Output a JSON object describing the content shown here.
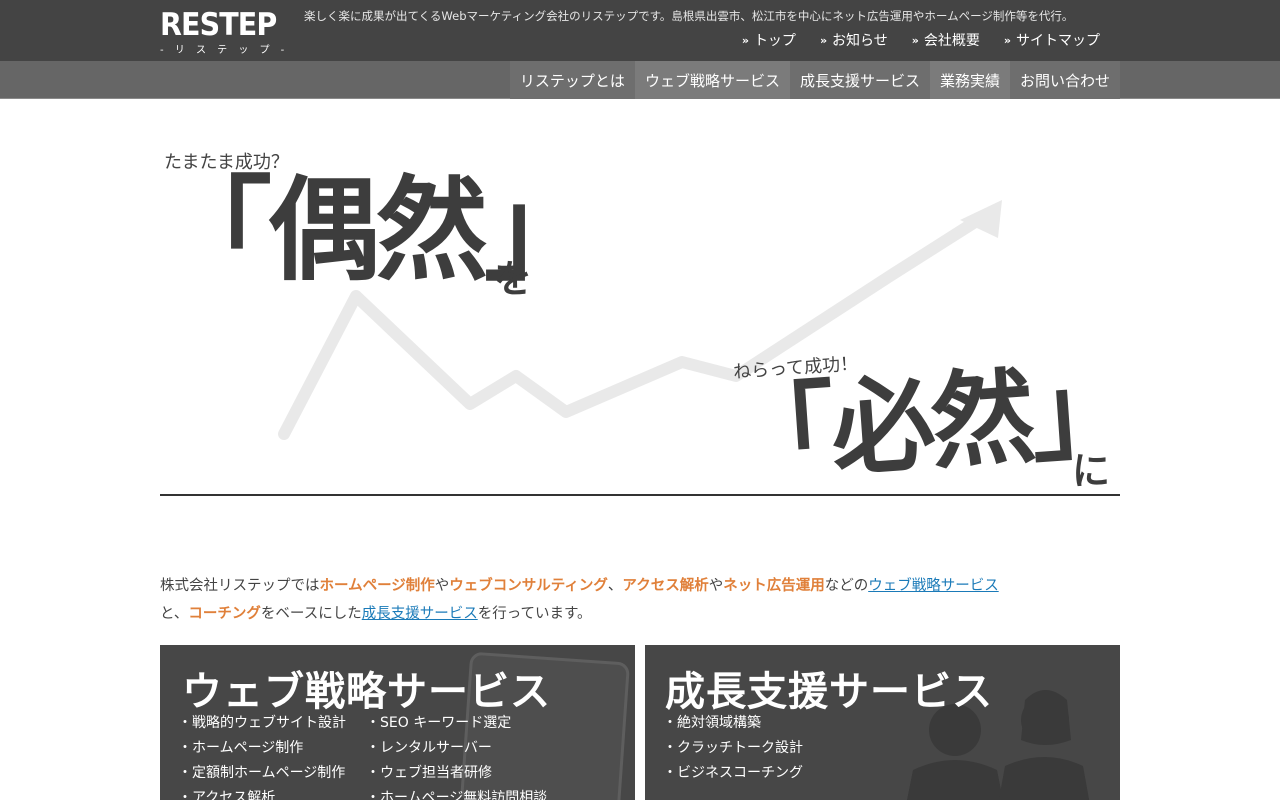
{
  "header": {
    "logo": {
      "main": "RESTEP",
      "sub": "- リ ス テ ッ プ -"
    },
    "tagline": "楽しく楽に成果が出てくるWebマーケティング会社のリステップです。島根県出雲市、松江市を中心にネット広告運用やホームページ制作等を代行。",
    "utility_nav": [
      {
        "label": "トップ",
        "icon": "double-chevron-right-icon"
      },
      {
        "label": "お知らせ",
        "icon": "double-chevron-right-icon"
      },
      {
        "label": "会社概要",
        "icon": "double-chevron-right-icon"
      },
      {
        "label": "サイトマップ",
        "icon": "double-chevron-right-icon"
      }
    ],
    "main_nav": [
      {
        "label": "リステップとは"
      },
      {
        "label": "ウェブ戦略サービス"
      },
      {
        "label": "成長支援サービス"
      },
      {
        "label": "業務実績"
      },
      {
        "label": "お問い合わせ"
      }
    ]
  },
  "hero": {
    "question_1": "たまたま成功？",
    "word_1": "「偶然」",
    "particle_1": "を",
    "question_2": "ねらって成功！",
    "word_2": "「必然」",
    "particle_2": "に"
  },
  "intro": {
    "t1": "株式会社リステップでは",
    "h1": "ホームページ制作",
    "t2": "や",
    "h2": "ウェブコンサルティング",
    "t3": "、",
    "h3": "アクセス解析",
    "t4": "や",
    "h4": "ネット広告運用",
    "t5": "などの",
    "l1": "ウェブ戦略サービス",
    "t6": "と、",
    "h5": "コーチング",
    "t7": "をベースにした",
    "l2": "成長支援サービス",
    "t8": "を行っています。"
  },
  "panels": {
    "web": {
      "title": "ウェブ戦略サービス",
      "col1": [
        "戦略的ウェブサイト設計",
        "ホームページ制作",
        "定額制ホームページ制作",
        "アクセス解析"
      ],
      "col2": [
        "SEO キーワード選定",
        "レンタルサーバー",
        "ウェブ担当者研修",
        "ホームページ無料訪問相談"
      ]
    },
    "growth": {
      "title": "成長支援サービス",
      "items": [
        "絶対領域構築",
        "クラッチトーク設計",
        "ビジネスコーチング"
      ]
    }
  },
  "colors": {
    "header_bg": "#444444",
    "nav_bg": "#666666",
    "highlight": "#e0803a",
    "link": "#1a7ab8",
    "panel_bg": "#474747"
  }
}
